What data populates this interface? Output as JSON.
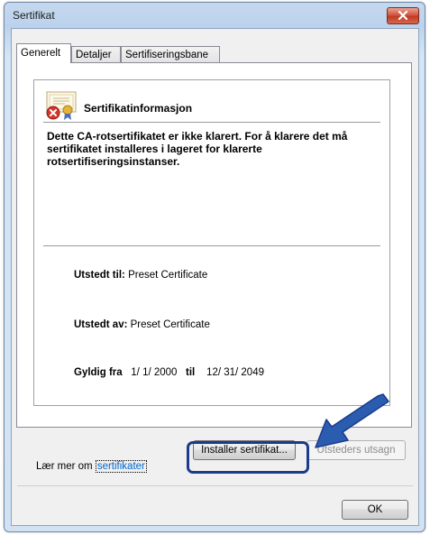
{
  "window": {
    "title": "Sertifikat",
    "close_icon": "close-icon"
  },
  "tabs": [
    {
      "label": "Generelt",
      "active": true
    },
    {
      "label": "Detaljer",
      "active": false
    },
    {
      "label": "Sertifiseringsbane",
      "active": false
    }
  ],
  "info": {
    "icon": "certificate-error-icon",
    "title": "Sertifikatinformasjon",
    "warning": "Dette CA-rotsertifikatet er ikke klarert. For å klarere det må sertifikatet installeres i lageret for klarerte rotsertifiseringsinstanser.",
    "issued_to_label": "Utstedt til:",
    "issued_to_value": "Preset Certificate",
    "issued_by_label": "Utstedt av:",
    "issued_by_value": "Preset Certificate",
    "valid_from_label": "Gyldig fra",
    "valid_from_value": "1/ 1/ 2000",
    "valid_to_label": "til",
    "valid_to_value": "12/ 31/ 2049"
  },
  "buttons": {
    "install": "Installer sertifikat...",
    "issuer_statement": "Utsteders utsagn",
    "ok": "OK"
  },
  "learn_more": {
    "prefix": "Lær mer om",
    "link": "sertifikater"
  },
  "colors": {
    "highlight": "#1b3b8b",
    "link": "#0066cc"
  }
}
